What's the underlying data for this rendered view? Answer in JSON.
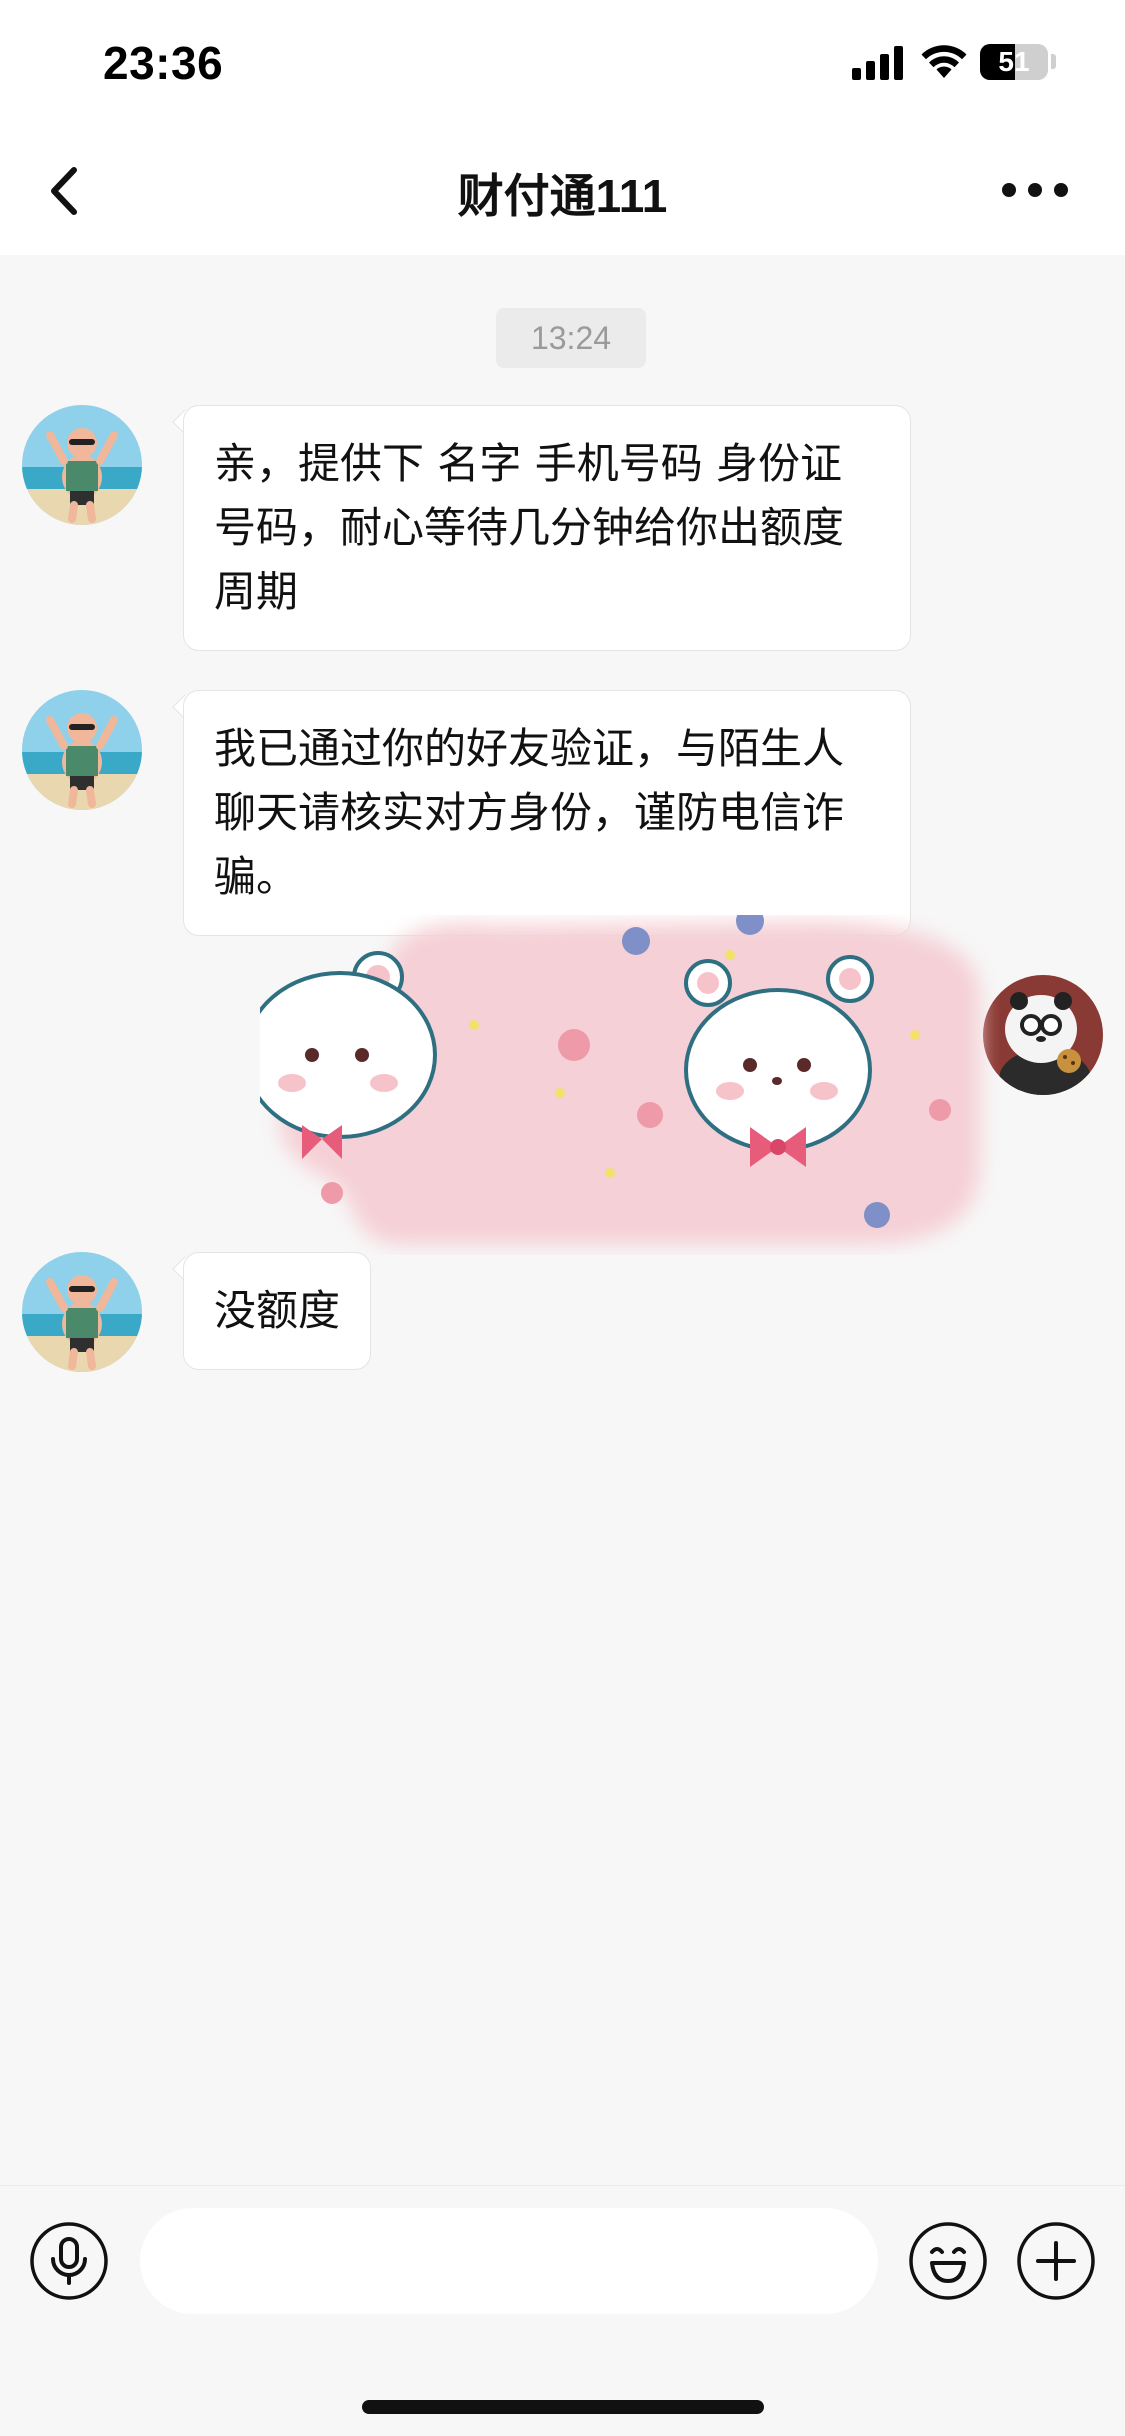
{
  "status_bar": {
    "time": "23:36",
    "battery_label": "51",
    "battery_level": 0.51
  },
  "nav": {
    "title": "财付通111",
    "back_icon": "chevron-left-icon",
    "more_icon": "more-dots-icon"
  },
  "chat": {
    "timestamp": "13:24",
    "messages": [
      {
        "sender": "contact",
        "type": "text",
        "text": "亲，提供下 名字 手机号码 身份证号码，耐心等待几分钟给你出额度周期"
      },
      {
        "sender": "contact",
        "type": "text",
        "text": "我已通过你的好友验证，与陌生人聊天请核实对方身份，谨防电信诈骗。"
      },
      {
        "sender": "self",
        "type": "sticker",
        "sticker": "white-bear-sticker"
      },
      {
        "sender": "contact",
        "type": "text",
        "text": "没额度"
      }
    ]
  },
  "input_bar": {
    "voice_icon": "microphone-icon",
    "emoji_icon": "smile-icon",
    "plus_icon": "plus-icon",
    "placeholder": ""
  },
  "colors": {
    "background": "#f7f7f7",
    "bubble": "#ffffff",
    "sticker_pink": "#f5d0d6"
  }
}
